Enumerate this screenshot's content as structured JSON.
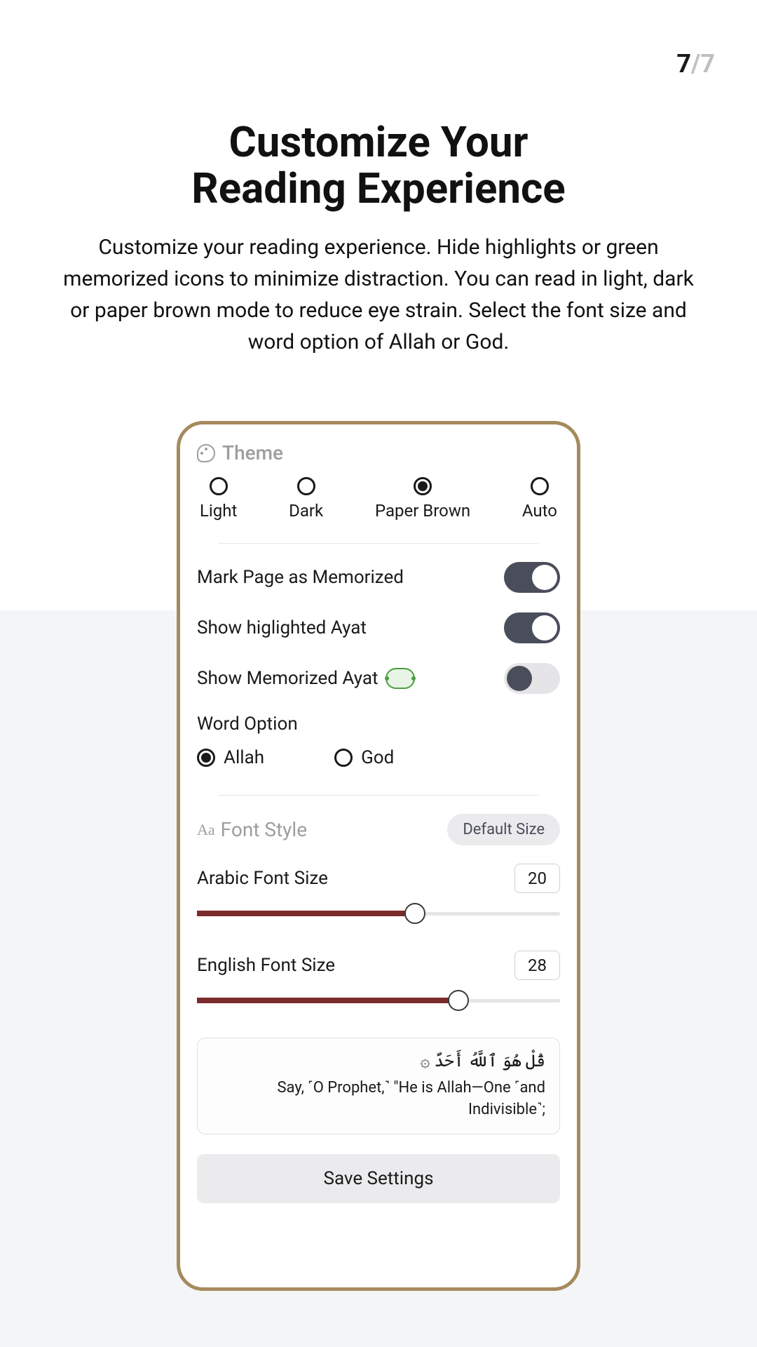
{
  "pageCounter": {
    "current": "7",
    "separator": "/",
    "total": "7"
  },
  "title": {
    "line1": "Customize Your",
    "line2": "Reading Experience"
  },
  "description": "Customize your reading experience. Hide highlights or green memorized icons to minimize distraction. You can read in light, dark or paper brown mode to reduce eye strain. Select the font size and word option of Allah or God.",
  "theme": {
    "sectionLabel": "Theme",
    "options": {
      "light": "Light",
      "dark": "Dark",
      "paperBrown": "Paper Brown",
      "auto": "Auto"
    },
    "selected": "paperBrown"
  },
  "toggles": {
    "markMemorized": {
      "label": "Mark Page as Memorized",
      "on": true
    },
    "showHighlighted": {
      "label": "Show higlighted Ayat",
      "on": true
    },
    "showMemorized": {
      "label": "Show Memorized Ayat",
      "on": false
    }
  },
  "wordOption": {
    "label": "Word Option",
    "allah": "Allah",
    "god": "God",
    "selected": "allah"
  },
  "fontStyle": {
    "sectionLabel": "Font Style",
    "defaultBtn": "Default Size",
    "arabic": {
      "label": "Arabic Font Size",
      "value": "20",
      "percent": 60
    },
    "english": {
      "label": "English Font Size",
      "value": "28",
      "percent": 72
    }
  },
  "preview": {
    "arabic": "قُلْ هُوَ ٱللَّهُ أَحَدٌ ۞",
    "english": "Say, ˹O Prophet,˺ \"He is Allah—One ˹and Indivisible˺;"
  },
  "saveBtn": "Save Settings"
}
